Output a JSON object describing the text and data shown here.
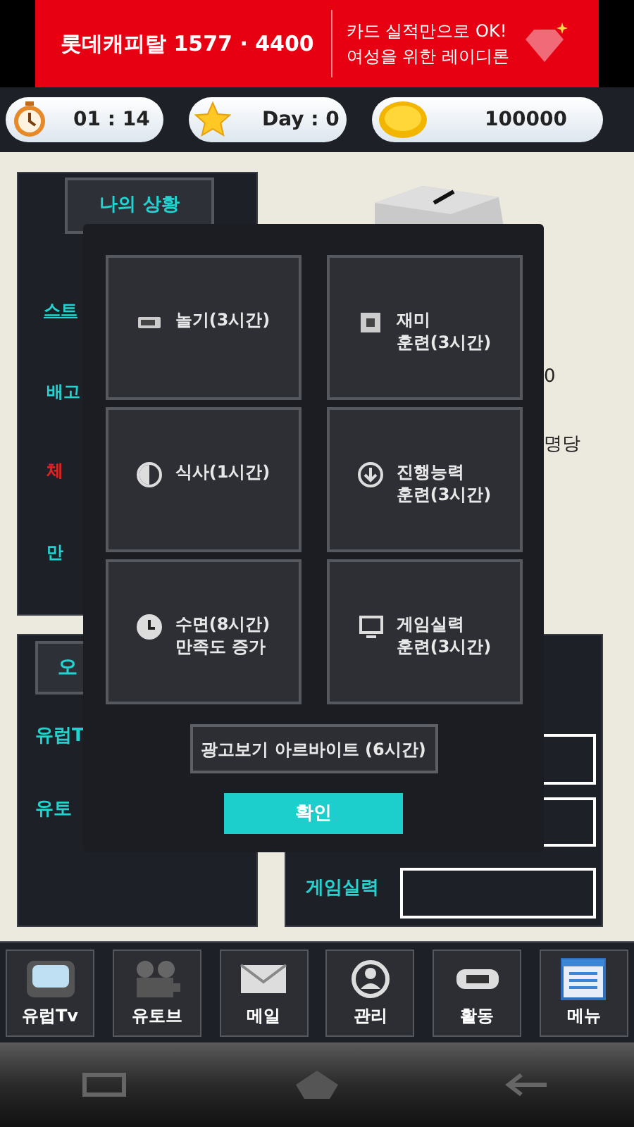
{
  "ad": {
    "brand": "롯데캐피탈 1577 · 4400",
    "line_1": "카드 실적만으로 OK!",
    "line_2": "여성을 위한 레이디론"
  },
  "status_bar": {
    "time": "01 : 14",
    "day": "Day : 0",
    "money": "100000"
  },
  "status_panel": {
    "title": "나의 상황",
    "labels": [
      {
        "text": "스트",
        "color": "#22d3d0",
        "underlined": true
      },
      {
        "text": "배고",
        "color": "#22d3d0",
        "underlined": false
      },
      {
        "text": "체",
        "color": "#e02424",
        "underlined": false
      },
      {
        "text": "만",
        "color": "#22d3d0",
        "underlined": false
      }
    ]
  },
  "background_texts": [
    "0",
    "명당"
  ],
  "channel_panel": {
    "button": "오",
    "labels": [
      "유럽T",
      "유토"
    ]
  },
  "skill_panel": {
    "label": "게임실력"
  },
  "dialog": {
    "options": [
      {
        "kind": "battery",
        "lines": [
          "놀기(3시간)"
        ]
      },
      {
        "kind": "dice",
        "lines": [
          "재미",
          "훈련(3시간)"
        ]
      },
      {
        "kind": "half-circle",
        "lines": [
          "식사(1시간)"
        ]
      },
      {
        "kind": "down-arrow",
        "lines": [
          "진행능력",
          "훈련(3시간)"
        ]
      },
      {
        "kind": "clock",
        "lines": [
          "수면(8시간)",
          "만족도 증가"
        ]
      },
      {
        "kind": "monitor",
        "lines": [
          "게임실력",
          "훈련(3시간)"
        ]
      }
    ],
    "ad_button": "광고보기 아르바이트 (6시간)",
    "confirm": "확인"
  },
  "nav": [
    {
      "kind": "tv",
      "label": "유럽Tv"
    },
    {
      "kind": "camera",
      "label": "유토브"
    },
    {
      "kind": "mail",
      "label": "메일"
    },
    {
      "kind": "person",
      "label": "관리"
    },
    {
      "kind": "activity",
      "label": "활동"
    },
    {
      "kind": "menu",
      "label": "메뉴"
    }
  ]
}
